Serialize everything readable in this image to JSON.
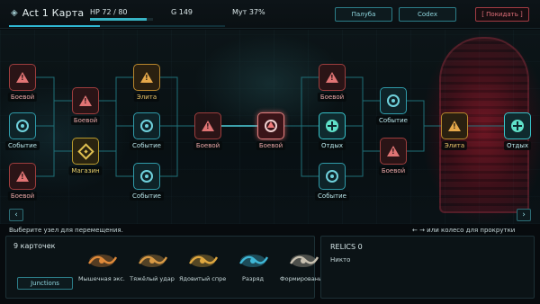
{
  "header": {
    "title": "Act 1 Карта",
    "hp_text": "HP 72 / 80",
    "hp_fraction": 0.9,
    "gold_text": "G 149",
    "mutation_text": "Мут 37%",
    "progress_fraction": 0.42,
    "buttons": {
      "deck": "Палуба",
      "codex": "Codex",
      "abandon": "[ Покидать ]"
    }
  },
  "map": {
    "nodes": [
      {
        "type": "battle",
        "label": "Боевой"
      },
      {
        "type": "event",
        "label": "Событие"
      },
      {
        "type": "battle",
        "label": "Боевой"
      },
      {
        "type": "battle",
        "label": "Боевой"
      },
      {
        "type": "shop",
        "label": "Магазин"
      },
      {
        "type": "elite",
        "label": "Элита"
      },
      {
        "type": "event",
        "label": "Событие"
      },
      {
        "type": "event",
        "label": "Событие"
      },
      {
        "type": "battle",
        "label": "Боевой"
      },
      {
        "type": "current",
        "label": "Боевой"
      },
      {
        "type": "battle",
        "label": "Боевой"
      },
      {
        "type": "rest",
        "label": "Отдых"
      },
      {
        "type": "event",
        "label": "Событие"
      },
      {
        "type": "event",
        "label": "Событие"
      },
      {
        "type": "battle",
        "label": "Боевой"
      },
      {
        "type": "elite",
        "label": "Элита"
      },
      {
        "type": "rest",
        "label": "Отдых"
      }
    ],
    "scroll_left": "‹",
    "scroll_right": "›"
  },
  "hints": {
    "left": "Выберите узел для перемещения.",
    "right": "← → или колесо для прокрутки"
  },
  "deck_panel": {
    "title": "9 карточек",
    "junctions_label": "Junctions",
    "cards": [
      {
        "name": "Мышечная экс...",
        "color": "#e08a3a"
      },
      {
        "name": "Тяжёлый удар",
        "color": "#d99a45"
      },
      {
        "name": "Ядовитый спрей",
        "color": "#e0a840"
      },
      {
        "name": "Разряд",
        "color": "#3fb7d6"
      },
      {
        "name": "Формировани...",
        "color": "#c8c0b0"
      }
    ]
  },
  "relics_panel": {
    "title": "RELICS 0",
    "empty_text": "Никто"
  }
}
